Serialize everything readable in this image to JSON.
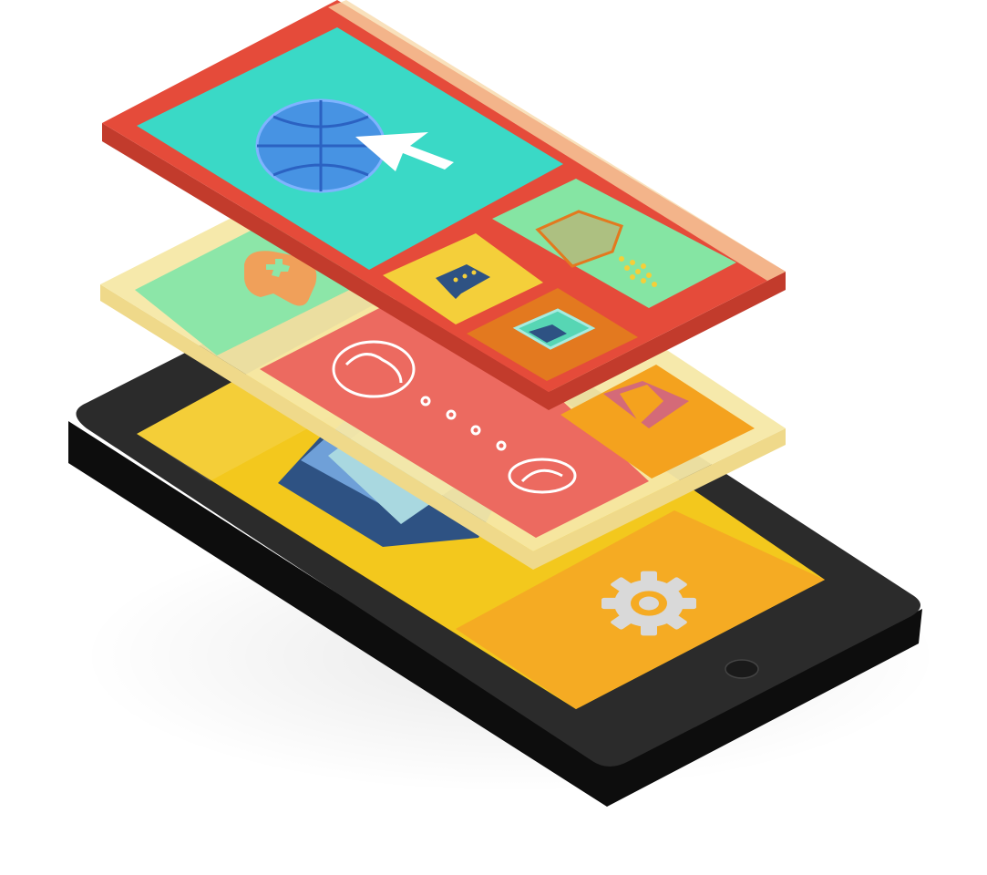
{
  "illustration": {
    "subject": "isometric-smartphone-with-floating-app-tile-layers",
    "layers": [
      {
        "name": "phone-base",
        "tiles": [
          {
            "color": "#f3c81d",
            "icon": "stacked-layers-icon"
          },
          {
            "color": "#f5ab23",
            "icon": "gear-icon"
          }
        ]
      },
      {
        "name": "middle-layer",
        "frame_color": "#f6e8a6",
        "tiles": [
          {
            "color": "#8ce6a8",
            "icon": "gamepad-icon"
          },
          {
            "color": "#ec6a60",
            "icon": "phone-call-icon"
          },
          {
            "color": "#f4a21e",
            "icon": "bookmark-icon"
          }
        ]
      },
      {
        "name": "top-layer",
        "frame_color": "#e54b3a",
        "tiles": [
          {
            "color": "#3ad9c6",
            "icon": "globe-cursor-icon"
          },
          {
            "color": "#85e5a3",
            "icon": "box-icon"
          },
          {
            "color": "#f4cf3a",
            "icon": "chat-icon"
          },
          {
            "color": "#e3791f",
            "icon": "picture-icon"
          }
        ]
      }
    ],
    "colors": {
      "phone_body": "#2b2b2b",
      "phone_edge": "#0d0d0d",
      "teal": "#3ad9c6",
      "mint": "#85e5a3",
      "coral": "#ec6a60",
      "red_frame": "#e54b3a",
      "yellow": "#f3c81d",
      "orange": "#f5ab23",
      "cream": "#f6e8a6",
      "navy": "#2e5283"
    }
  }
}
